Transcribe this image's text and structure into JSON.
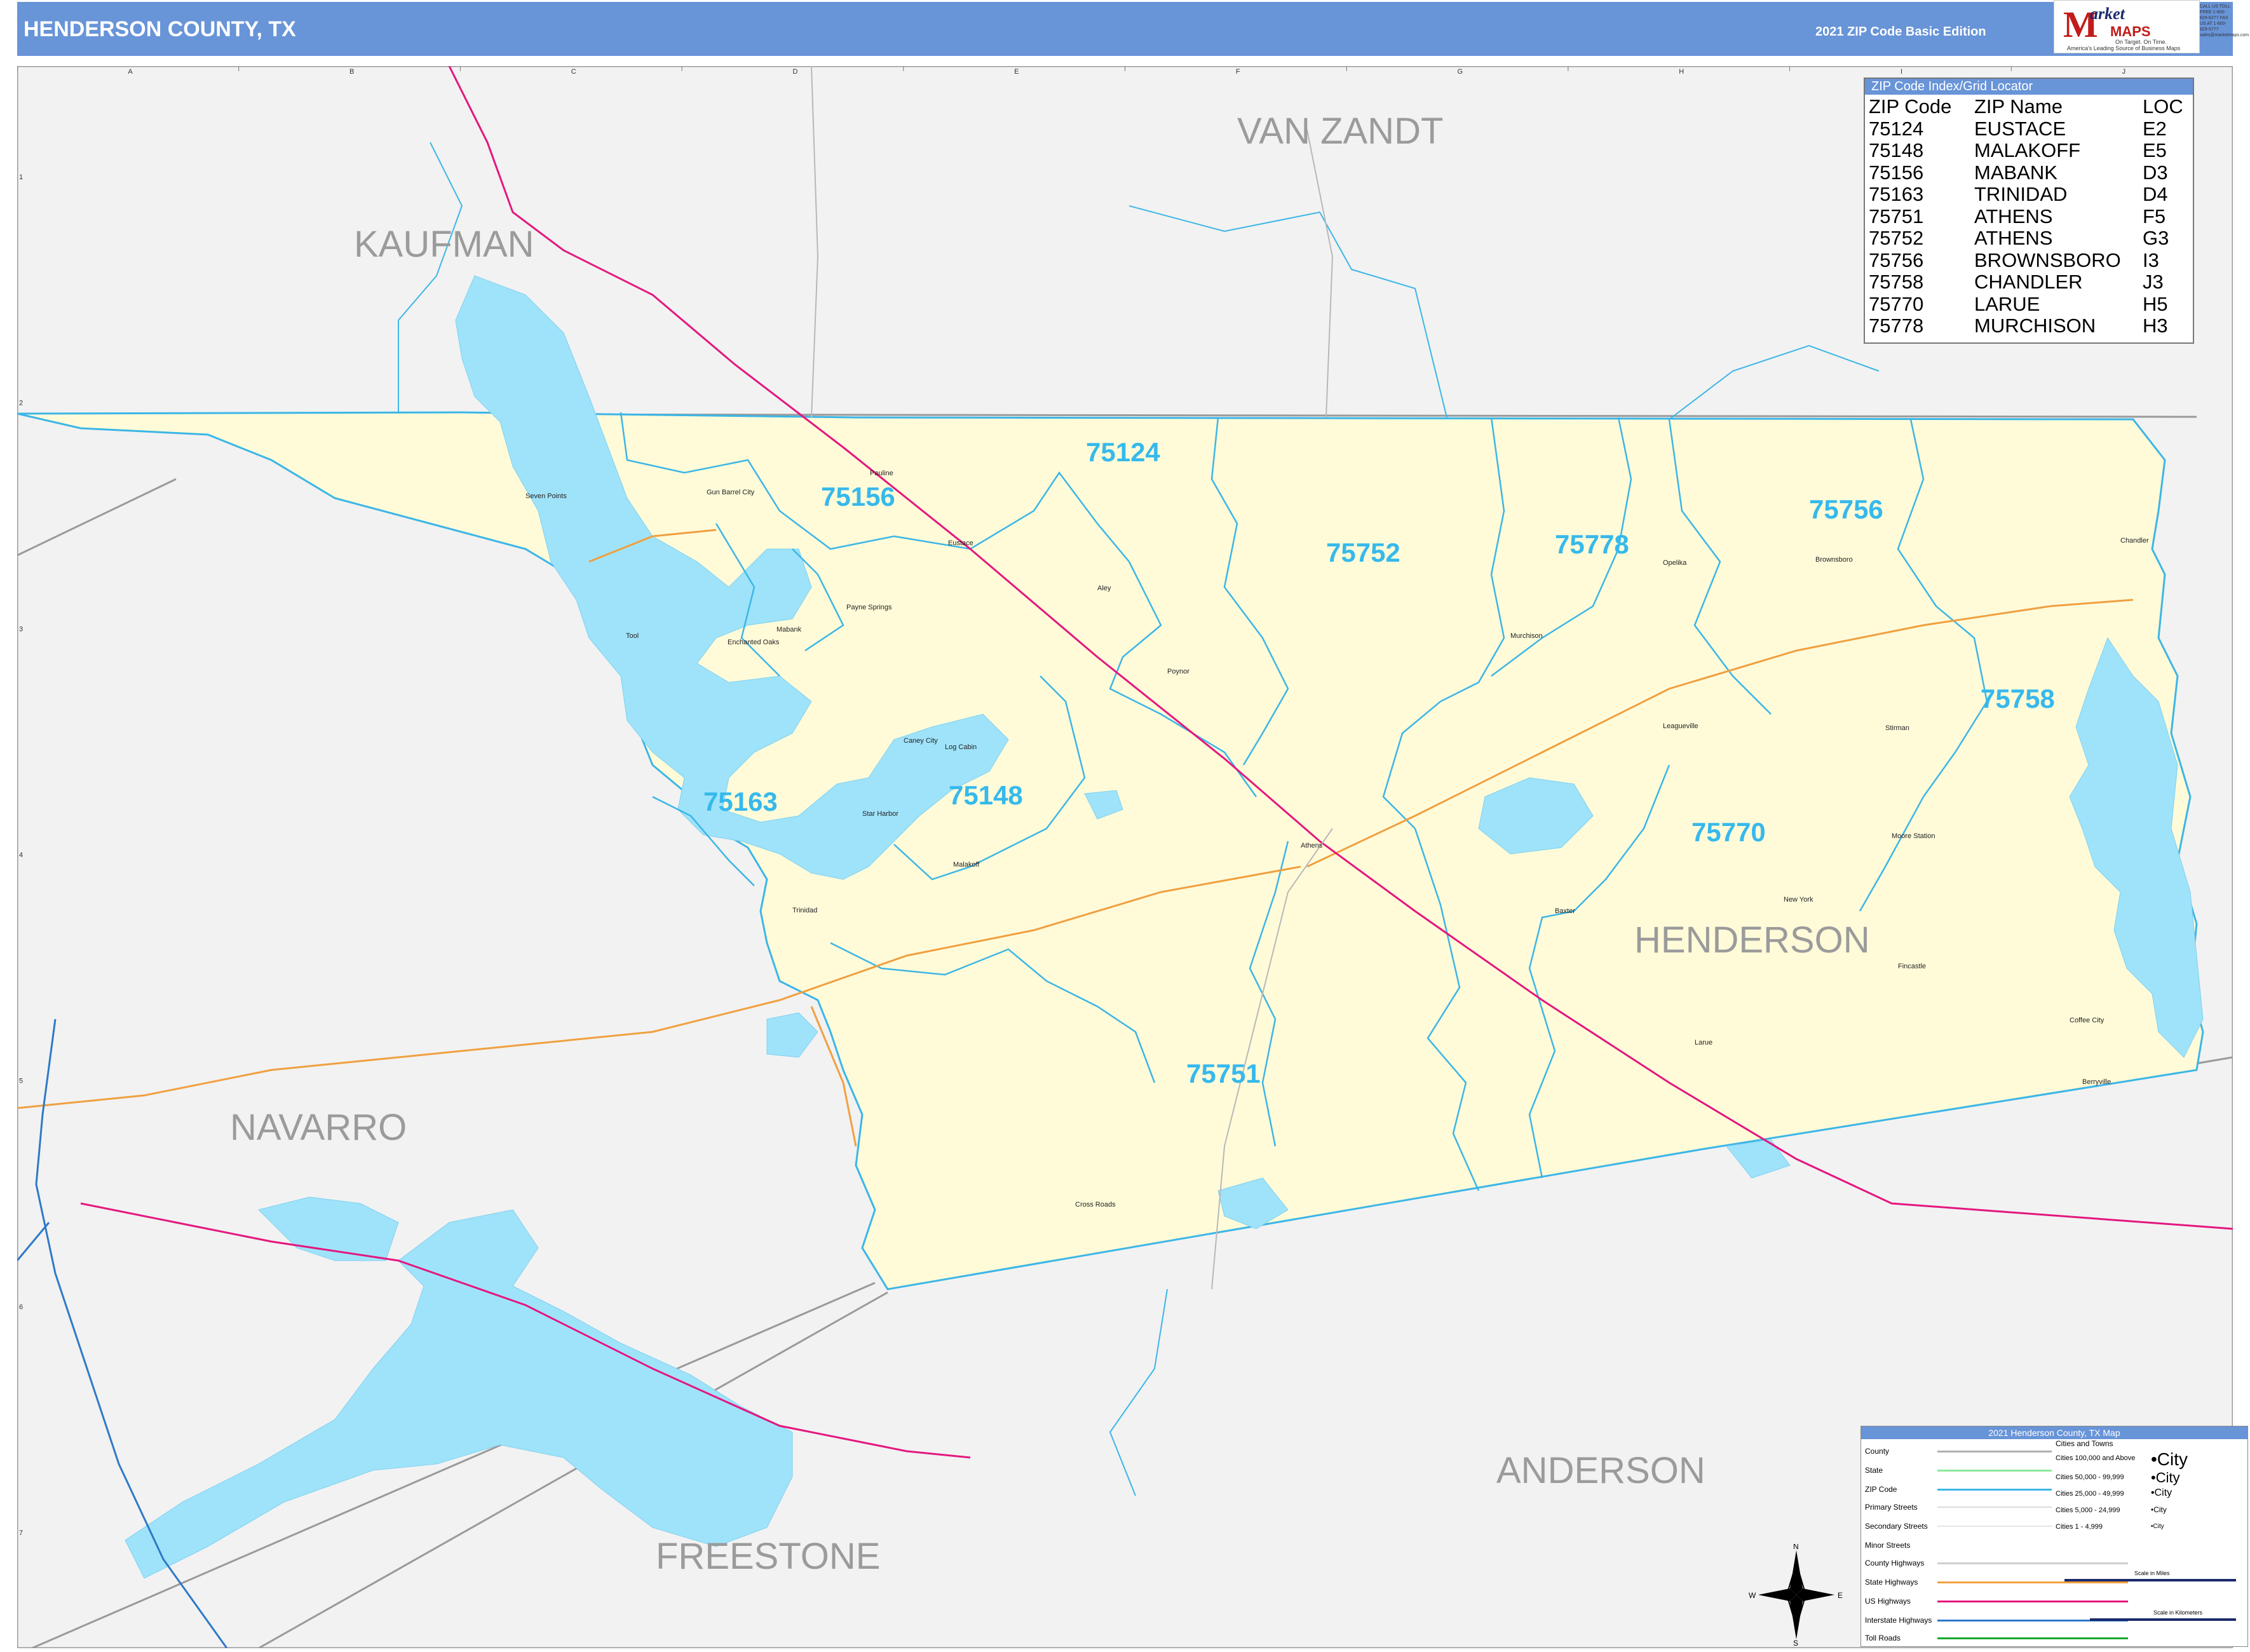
{
  "header": {
    "title": "HENDERSON COUNTY, TX",
    "edition": "2021 ZIP Code Basic Edition"
  },
  "logo": {
    "letter": "M",
    "word1": "arket",
    "word2": "MAPS",
    "tagline1": "On Target. On Time.",
    "tagline2": "America's Leading Source of Business Maps",
    "contact": "CALL US TOLL FREE 1-800-829-6277 FAX US AT 1-800-829-5777 sales@marketmaps.com"
  },
  "grid": {
    "columns": [
      "A",
      "B",
      "C",
      "D",
      "E",
      "F",
      "G",
      "H",
      "I",
      "J"
    ],
    "rows": [
      "1",
      "2",
      "3",
      "4",
      "5",
      "6",
      "7"
    ]
  },
  "counties": [
    {
      "name": "VAN ZANDT"
    },
    {
      "name": "KAUFMAN"
    },
    {
      "name": "HENDERSON"
    },
    {
      "name": "NAVARRO"
    },
    {
      "name": "ANDERSON"
    },
    {
      "name": "FREESTONE"
    }
  ],
  "zip_labels": [
    "75124",
    "75156",
    "75752",
    "75778",
    "75756",
    "75758",
    "75163",
    "75148",
    "75770",
    "75751"
  ],
  "towns": [
    "Gun Barrel City",
    "Seven Points",
    "Mabank",
    "Eustace",
    "Payne Springs",
    "Enchanted Oaks",
    "Tool",
    "Caney City",
    "Log Cabin",
    "Star Harbor",
    "Malakoff",
    "Trinidad",
    "Athens",
    "Murchison",
    "Brownsboro",
    "Chandler",
    "Poynor",
    "Berryville",
    "Larue",
    "Coffee City",
    "Moore Station",
    "New York",
    "Cross Roads",
    "Baxter",
    "Pauline",
    "Aley",
    "Opelika",
    "Leagueville",
    "Stirman",
    "Fincastle"
  ],
  "zip_index": {
    "title": "ZIP Code Index/Grid Locator",
    "headers": [
      "ZIP Code",
      "ZIP Name",
      "LOC"
    ],
    "rows": [
      [
        "75124",
        "EUSTACE",
        "E2"
      ],
      [
        "75148",
        "MALAKOFF",
        "E5"
      ],
      [
        "75156",
        "MABANK",
        "D3"
      ],
      [
        "75163",
        "TRINIDAD",
        "D4"
      ],
      [
        "75751",
        "ATHENS",
        "F5"
      ],
      [
        "75752",
        "ATHENS",
        "G3"
      ],
      [
        "75756",
        "BROWNSBORO",
        "I3"
      ],
      [
        "75758",
        "CHANDLER",
        "J3"
      ],
      [
        "75770",
        "LARUE",
        "H5"
      ],
      [
        "75778",
        "MURCHISON",
        "H3"
      ]
    ]
  },
  "legend": {
    "title": "2021 Henderson County, TX Map",
    "items": [
      "County",
      "State",
      "ZIP Code",
      "Primary Streets",
      "Secondary Streets",
      "Minor Streets",
      "County Highways",
      "State Highways",
      "US Highways",
      "Interstate Highways",
      "Toll Roads"
    ],
    "cities_title": "Cities and Towns",
    "cities": [
      {
        "label": "Cities 100,000 and Above",
        "sample": "•City"
      },
      {
        "label": "Cities 50,000 - 99,999",
        "sample": "•City"
      },
      {
        "label": "Cities 25,000 - 49,999",
        "sample": "•City"
      },
      {
        "label": "Cities 5,000 - 24,999",
        "sample": "•City"
      },
      {
        "label": "Cities 1 - 4,999",
        "sample": "•City"
      }
    ],
    "scale_miles": "Scale in Miles",
    "scale_km": "Scale in Kilometers"
  },
  "compass": {
    "n": "N",
    "s": "S",
    "e": "E",
    "w": "W"
  },
  "colors": {
    "header": "#6894d8",
    "county_fill": "#fffbd9",
    "outside_fill": "#f2f2f2",
    "water": "#9fe3fa",
    "zip_line": "#3cb6e6",
    "zip_label": "#36b9ec",
    "us_highway": "#e4177f",
    "state_highway": "#f0a040",
    "interstate": "#2f79c7",
    "county_label": "#9b9b9b"
  }
}
